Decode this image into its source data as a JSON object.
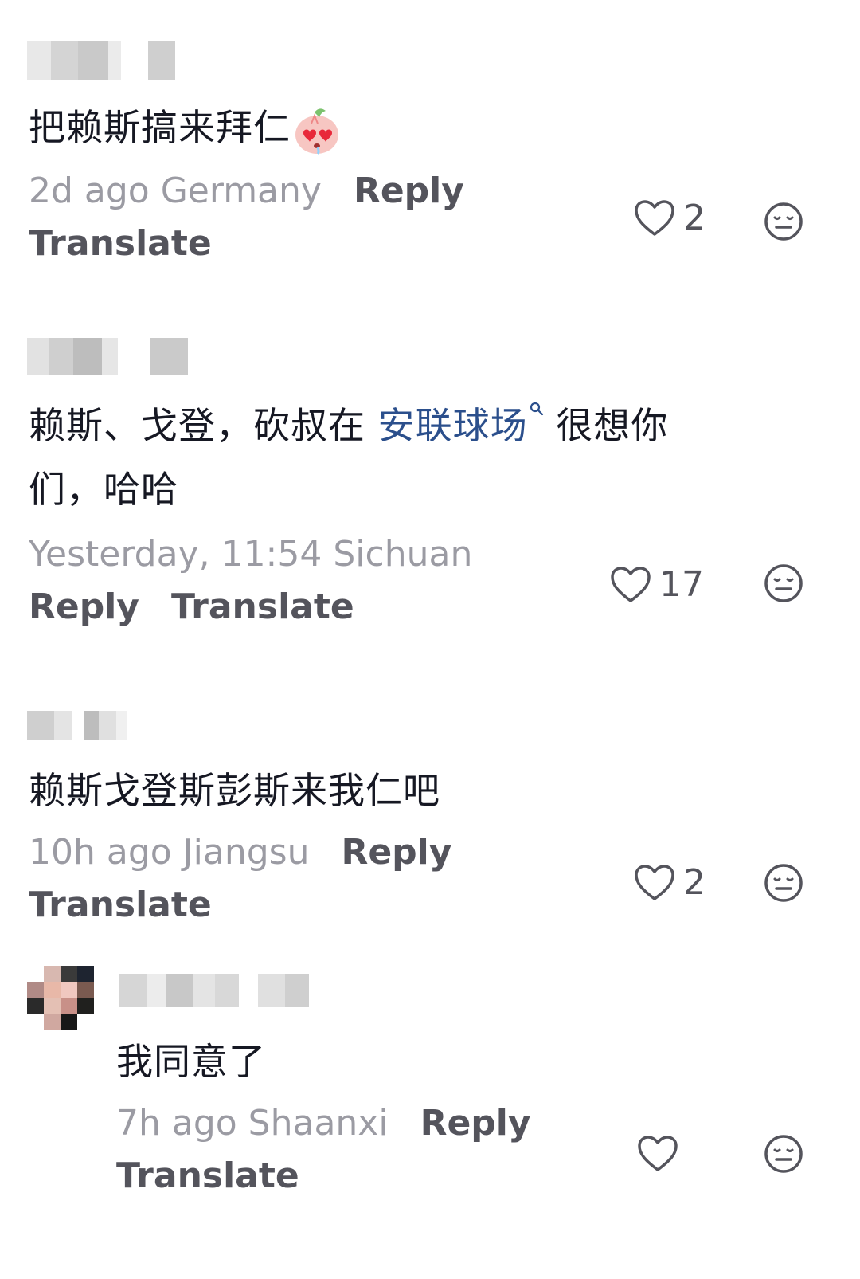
{
  "comments": [
    {
      "text": "把赖斯搞来拜仁",
      "time_location": "2d ago Germany",
      "reply_label": "Reply",
      "translate_label": "Translate",
      "likes": "2"
    },
    {
      "text_before_link": "赖斯、戈登，砍叔在 ",
      "link_text": "安联球场",
      "text_after_link": " 很想你",
      "text_line2": "们，哈哈",
      "time_location": "Yesterday, 11:54 Sichuan",
      "reply_label": "Reply",
      "translate_label": "Translate",
      "likes": "17"
    },
    {
      "text": "赖斯戈登斯彭斯来我仁吧",
      "time_location": "10h ago Jiangsu",
      "reply_label": "Reply",
      "translate_label": "Translate",
      "likes": "2"
    },
    {
      "text": "我同意了",
      "time_location": "7h ago Shaanxi",
      "reply_label": "Reply",
      "translate_label": "Translate",
      "likes": ""
    }
  ],
  "icons": {
    "like": "heart-outline-icon",
    "dislike": "neutral-face-icon",
    "emoji": "heart-eyes-peach-emoji",
    "link": "search-icon"
  },
  "colors": {
    "text": "#161823",
    "meta": "#9b9ba3",
    "action": "#54545c",
    "link": "#2b4f8c"
  }
}
